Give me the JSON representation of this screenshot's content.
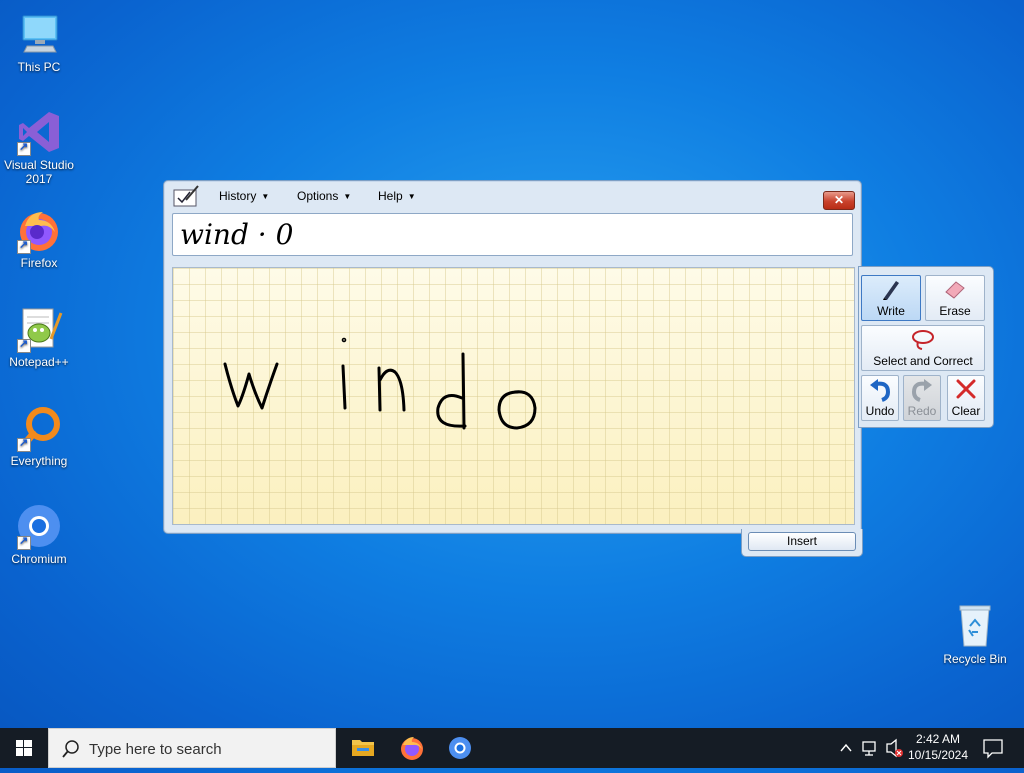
{
  "desktop": {
    "icons": [
      {
        "label": "This PC"
      },
      {
        "label": "Visual Studio 2017"
      },
      {
        "label": "Firefox"
      },
      {
        "label": "Notepad++"
      },
      {
        "label": "Everything"
      },
      {
        "label": "Chromium"
      },
      {
        "label": "Recycle Bin"
      }
    ]
  },
  "tip": {
    "menu": {
      "history": "History",
      "options": "Options",
      "help": "Help"
    },
    "close": "✕",
    "preview_text": "wind · 0",
    "handwriting": "windo",
    "insert": "Insert",
    "tools": {
      "write": "Write",
      "erase": "Erase",
      "select_correct": "Select and Correct",
      "undo": "Undo",
      "redo": "Redo",
      "clear": "Clear"
    }
  },
  "taskbar": {
    "search_placeholder": "Type here to search",
    "time": "2:42 AM",
    "date": "10/15/2024"
  },
  "colors": {
    "desktop_accent": "#0f7ee2",
    "pad_background": "#fdf6d2",
    "close_button": "#c9422c",
    "taskbar": "#151c25"
  }
}
